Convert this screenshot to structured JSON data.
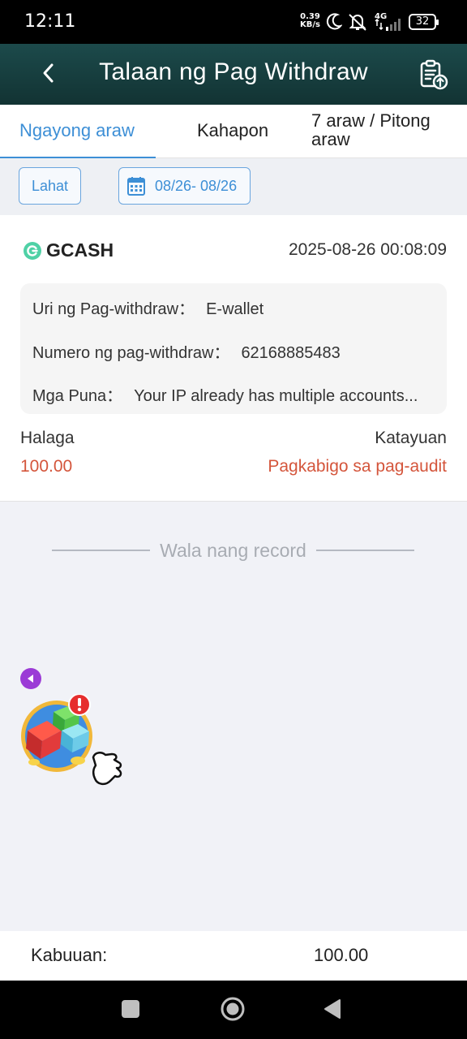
{
  "status_bar": {
    "time": "12:11",
    "net_speed_value": "0.39",
    "net_speed_unit": "KB/s",
    "network": "4G",
    "battery": "32",
    "icons": [
      "moon-icon",
      "mute-vibrate-icon",
      "signal-icon"
    ]
  },
  "header": {
    "title": "Talaan ng Pag Withdraw",
    "back_icon": "chevron-left-icon",
    "history_icon": "clipboard-upload-icon",
    "bg_color": "#1c4a4b"
  },
  "tabs": [
    {
      "label": "Ngayong araw",
      "active": true
    },
    {
      "label": "Kahapon",
      "active": false
    },
    {
      "label": "7 araw / Pitong araw",
      "active": false
    }
  ],
  "filters": {
    "all_label": "Lahat",
    "date_range": "08/26- 08/26",
    "accent_color": "#3d8fd6"
  },
  "record": {
    "method": "GCASH",
    "datetime": "2025-08-26 00:08:09",
    "details": [
      {
        "label": "Uri ng Pag-withdraw：",
        "value": "E-wallet"
      },
      {
        "label": "Numero ng pag-withdraw：",
        "value": "62168885483"
      },
      {
        "label": "Mga Puna：",
        "value": "Your IP already has multiple accounts..."
      }
    ],
    "amount_label": "Halaga",
    "amount_value": "100.00",
    "status_label": "Katayuan",
    "status_value": "Pagkabigo sa pag-audit",
    "status_color": "#d4553b"
  },
  "no_more_text": "Wala nang record",
  "total": {
    "label": "Kabuuan:",
    "value": "100.00"
  },
  "nav": {
    "buttons": [
      "recents-icon",
      "home-icon",
      "back-icon"
    ]
  }
}
